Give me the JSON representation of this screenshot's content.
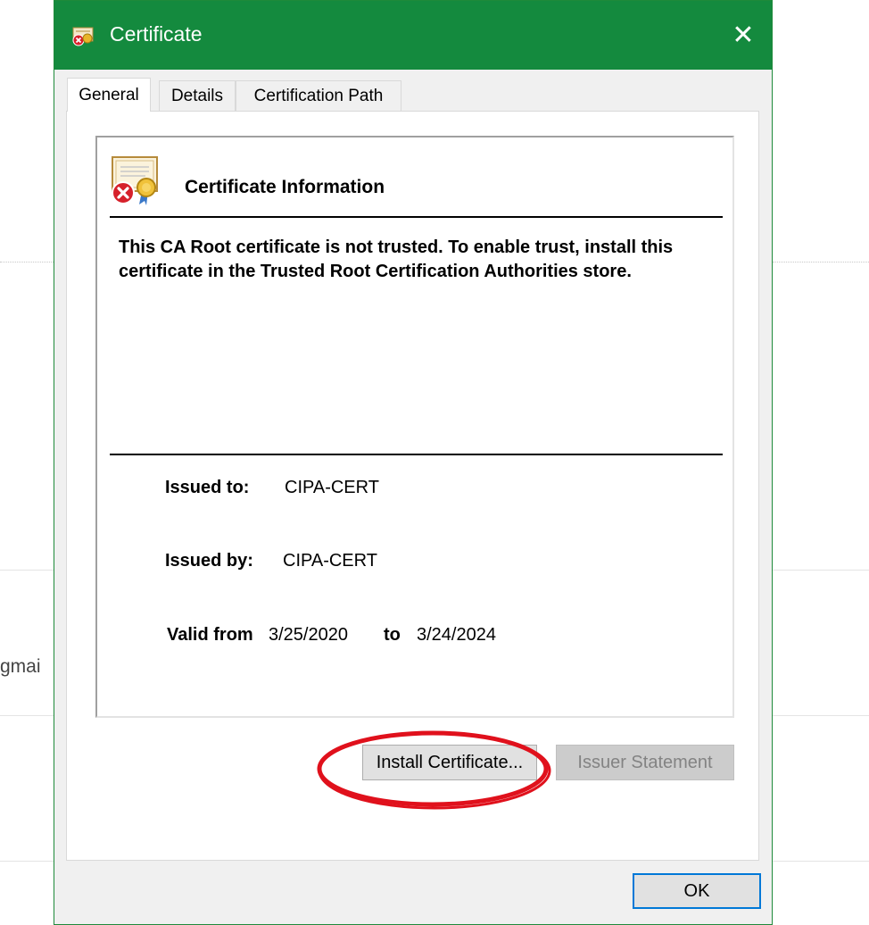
{
  "background": {
    "partial_text": "gmai"
  },
  "dialog": {
    "title": "Certificate",
    "close_glyph": "✕",
    "tabs": [
      {
        "label": "General",
        "active": true
      },
      {
        "label": "Details",
        "active": false
      },
      {
        "label": "Certification Path",
        "active": false
      }
    ],
    "cert_info": {
      "heading": "Certificate Information",
      "warning": "This CA Root certificate is not trusted. To enable trust, install this certificate in the Trusted Root Certification Authorities store.",
      "issued_to_label": "Issued to:",
      "issued_to_value": "CIPA-CERT",
      "issued_by_label": "Issued by:",
      "issued_by_value": "CIPA-CERT",
      "valid_from_label": "Valid from",
      "valid_from_value": "3/25/2020",
      "valid_to_label": "to",
      "valid_to_value": "3/24/2024"
    },
    "buttons": {
      "install": "Install Certificate...",
      "issuer_statement": "Issuer Statement",
      "ok": "OK"
    }
  },
  "colors": {
    "titlebar": "#148a3e",
    "highlight": "#e0111c",
    "default_button_border": "#0078d7"
  },
  "icons": {
    "title": "certificate-error-icon",
    "info": "certificate-error-icon",
    "close": "close-icon"
  }
}
